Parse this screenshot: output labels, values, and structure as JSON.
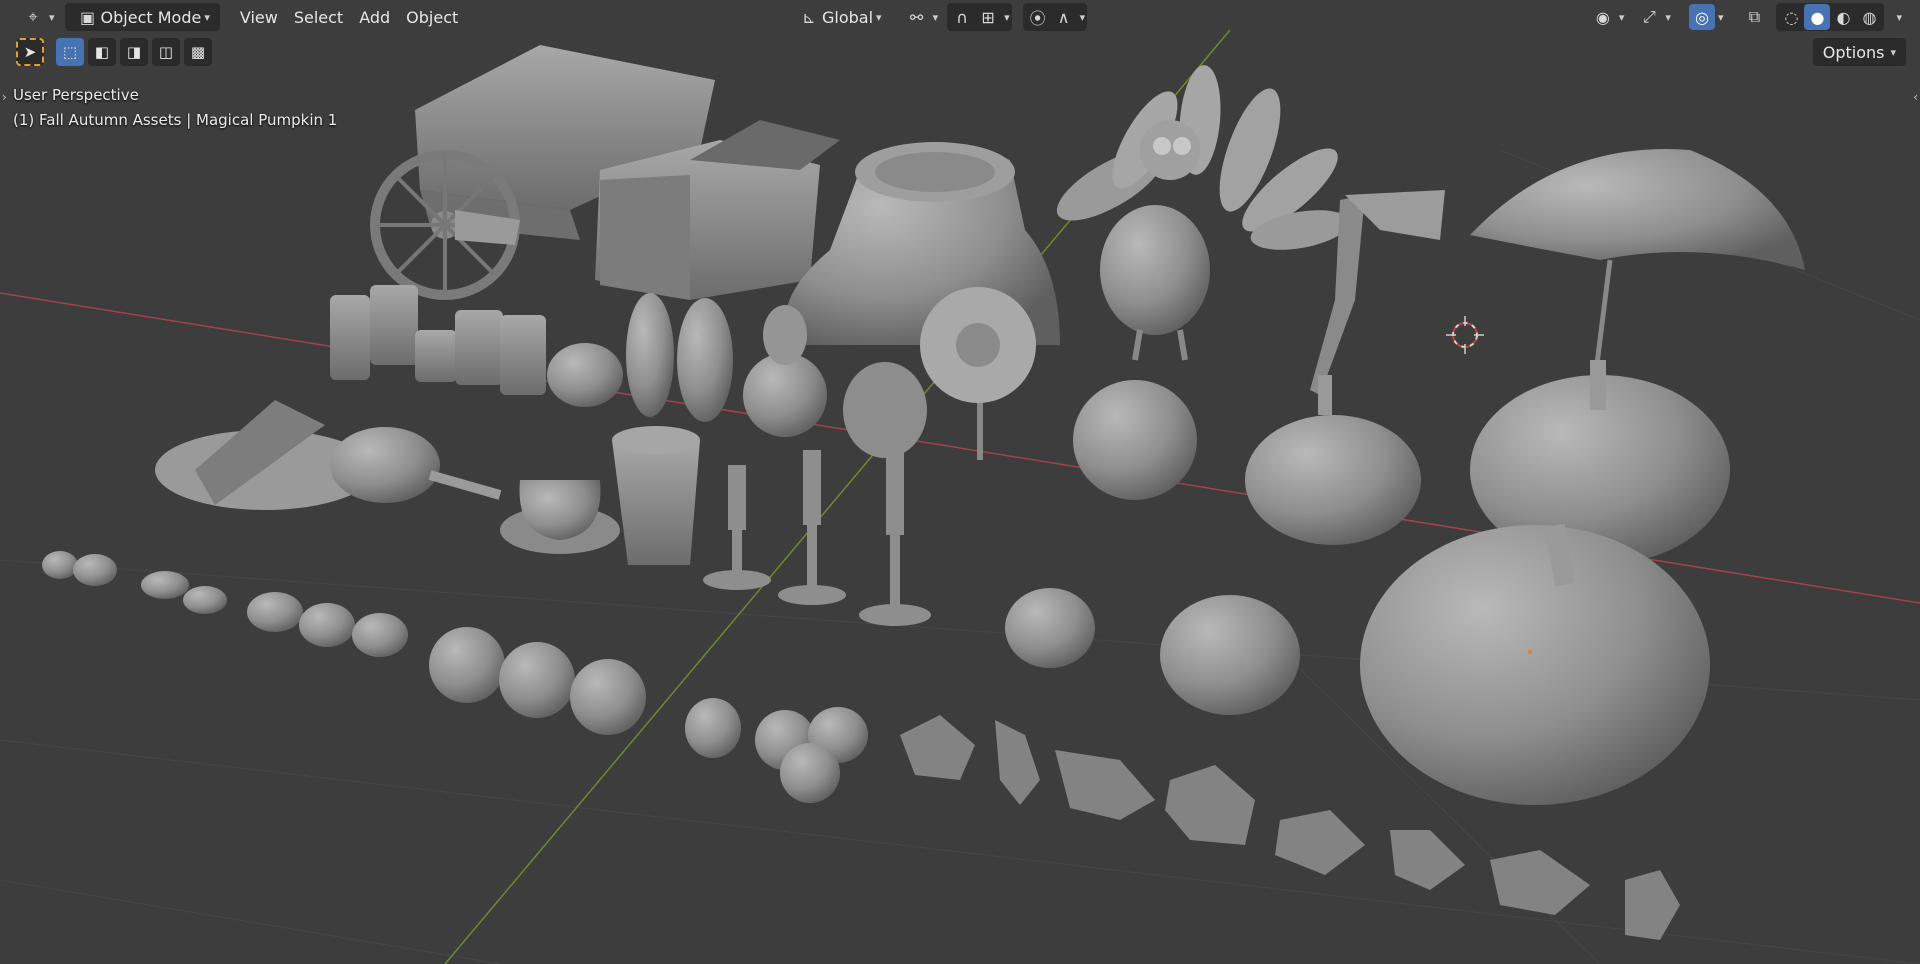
{
  "header": {
    "mode_label": "Object Mode",
    "menus": [
      "View",
      "Select",
      "Add",
      "Object"
    ],
    "transform_orientation": "Global",
    "options_label": "Options"
  },
  "overlay": {
    "view_name": "User Perspective",
    "scene_info": "(1) Fall Autumn Assets | Magical Pumpkin 1"
  },
  "icons": {
    "editor_type": "camera-tripod-icon",
    "mode": "object-mode-icon",
    "transform": "axes-icon",
    "pivot": "link-icon",
    "snap": "magnet-icon",
    "proportional": "proportional-edit-icon",
    "visibility": "eye-icon",
    "gizmo": "gizmo-icon",
    "overlays": "overlay-icon",
    "xray": "xray-icon",
    "shading": [
      "wireframe-shading-icon",
      "solid-shading-icon",
      "material-shading-icon",
      "rendered-shading-icon"
    ]
  },
  "colors": {
    "viewport_bg": "#3d3d3d",
    "accent": "#4772b3",
    "x_axis": "#a3414f",
    "y_axis": "#6d8a2f",
    "model": "#8c8c8c"
  }
}
